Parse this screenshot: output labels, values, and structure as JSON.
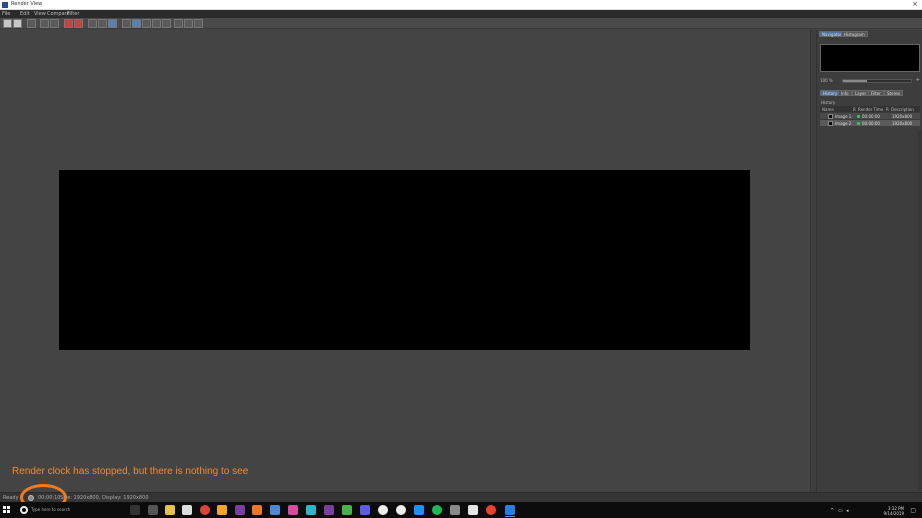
{
  "window": {
    "title": "Render View",
    "close_glyph": "×"
  },
  "menubar": {
    "items": [
      "File",
      "Edit",
      "View",
      "Compare",
      "Filter"
    ]
  },
  "sidepanel": {
    "tabs": [
      "Navigator",
      "Histogram"
    ],
    "zoom_value": "100 %",
    "zoom_level": 0.35,
    "subtabs": [
      "History",
      "Info",
      "Layer",
      "Filter",
      "Stereo"
    ],
    "history_title": "History",
    "history_headers": [
      "Name",
      "R",
      "Render Time",
      "R",
      "Description"
    ],
    "history_rows": [
      {
        "name": "Image 1",
        "time": "00:00:00",
        "desc": "1920x800"
      },
      {
        "name": "Image 2",
        "time": "00:00:00",
        "desc": "1920x800"
      }
    ]
  },
  "statusbar": {
    "left_text": "Ready",
    "clock_text": "00:00:10",
    "message": "Size: 1920x800, Display: 1920x800"
  },
  "annotation": {
    "text": "Render clock has stopped, but there is nothing to see",
    "color": "#f28a2a"
  },
  "taskbar": {
    "search_placeholder": "Type here to search",
    "clock_time": "3:32 PM",
    "clock_date": "9/14/2019"
  }
}
